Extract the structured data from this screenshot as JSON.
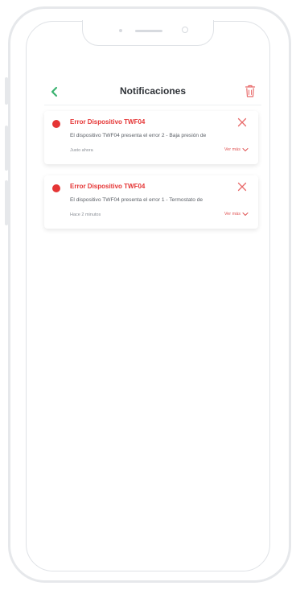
{
  "header": {
    "title": "Notificaciones",
    "back_icon": "chevron-left-icon",
    "delete_icon": "trash-icon"
  },
  "colors": {
    "accent_green": "#3cb371",
    "error_red": "#e53535",
    "trash_red": "#e86a6a"
  },
  "notifications": [
    {
      "title": "Error Dispositivo TWF04",
      "body": "El dispositivo TWF04 presenta el error 2 - Baja presión de",
      "time": "Justo ahora",
      "see_more": "Ver más"
    },
    {
      "title": "Error Dispositivo TWF04",
      "body": "El dispositivo TWF04 presenta el error 1 - Termostato de",
      "time": "Hace 2 minutos",
      "see_more": "Ver más"
    }
  ]
}
